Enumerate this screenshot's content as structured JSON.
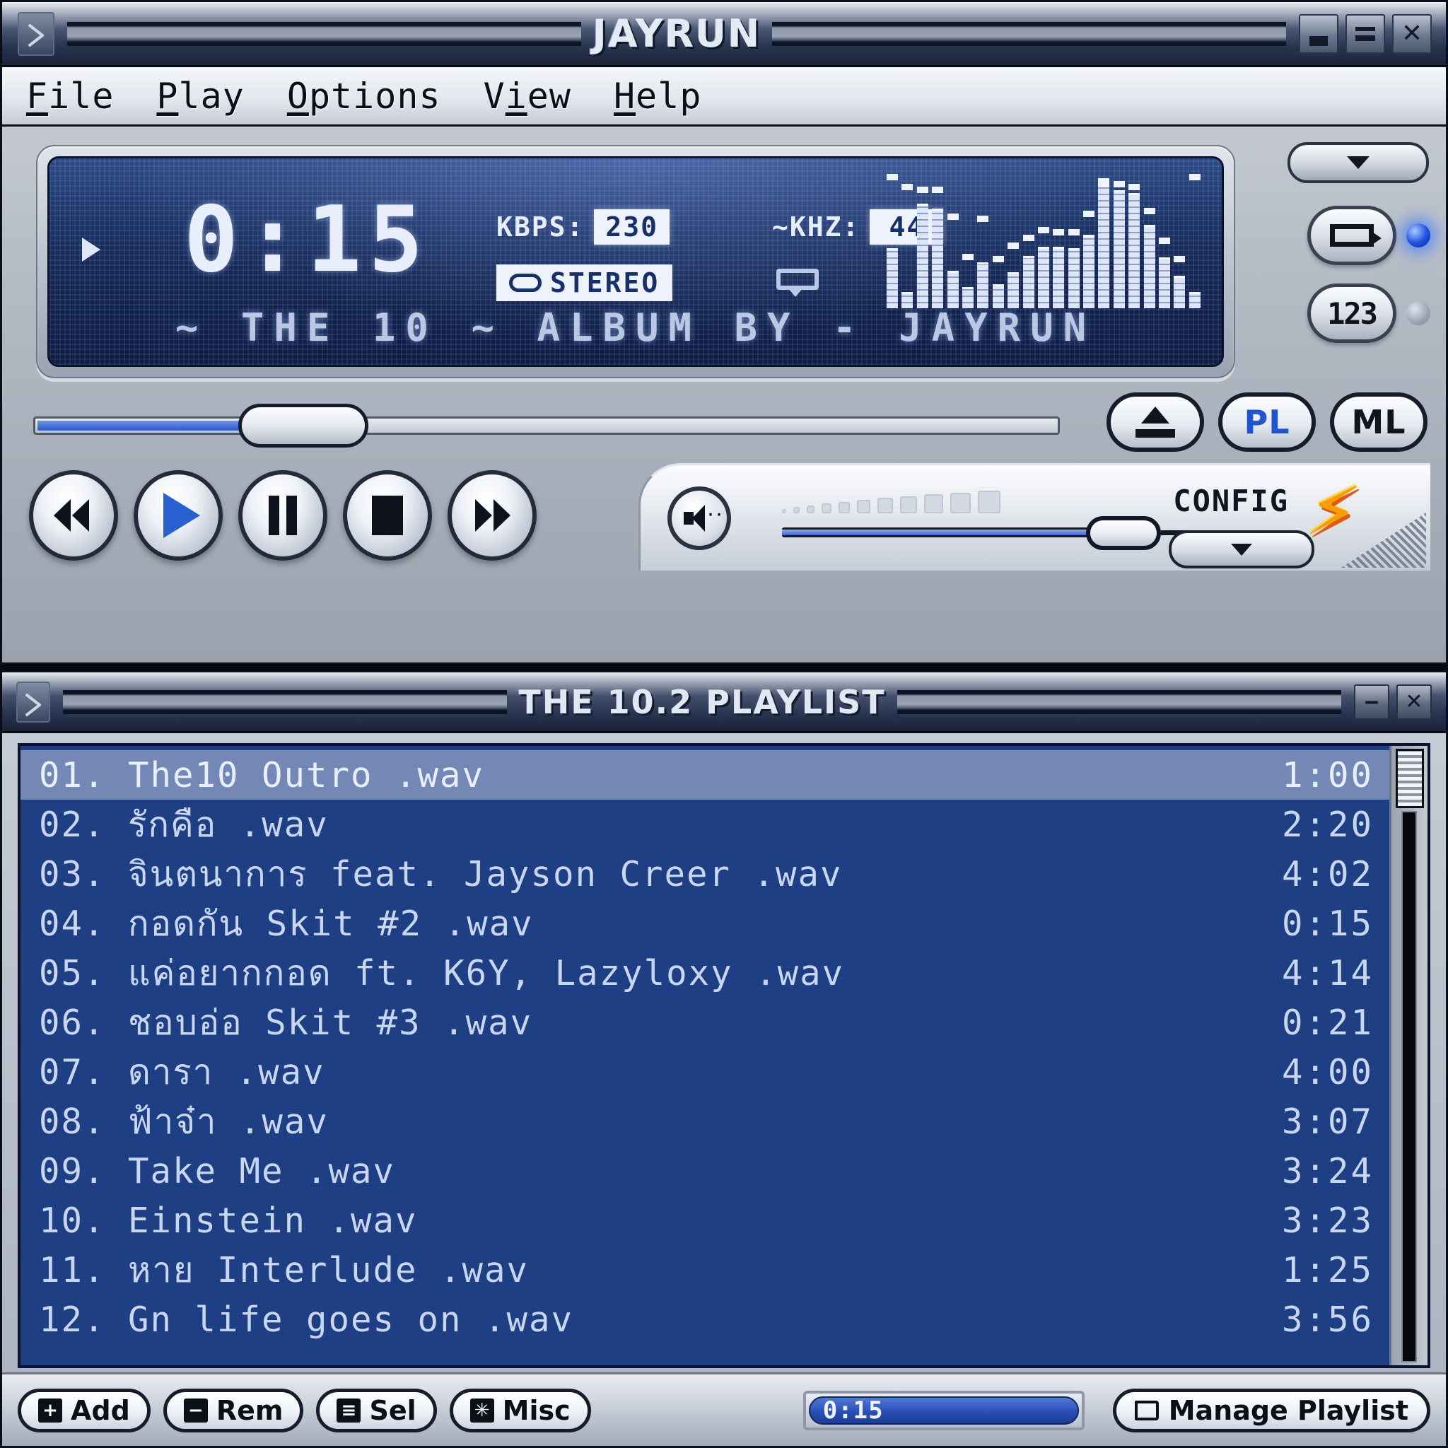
{
  "main_window": {
    "title": "JAYRUN",
    "sys_icon": "winamp-logo-icon",
    "window_buttons": [
      {
        "name": "minimize-button",
        "glyph": "minimize-icon"
      },
      {
        "name": "shade-button",
        "glyph": "shade-icon"
      },
      {
        "name": "close-button",
        "glyph": "close-icon"
      }
    ],
    "menu": [
      {
        "pre": "",
        "acc": "F",
        "post": "ile"
      },
      {
        "pre": "",
        "acc": "P",
        "post": "lay"
      },
      {
        "pre": "",
        "acc": "O",
        "post": "ptions"
      },
      {
        "pre": "V",
        "acc": "i",
        "post": "ew"
      },
      {
        "pre": "",
        "acc": "H",
        "post": "elp"
      }
    ],
    "display": {
      "time": "0:15",
      "play_state": "playing",
      "kbps_label": "KBPS:",
      "kbps_value": "230",
      "khz_label": "~KHZ:",
      "khz_value": "44",
      "stereo_label": "STEREO",
      "track_title": "~ THE 10 ~ ALBUM BY - JAYRUN",
      "spectrum_bars": [
        45,
        12,
        78,
        74,
        28,
        16,
        34,
        18,
        27,
        39,
        46,
        46,
        45,
        55,
        92,
        88,
        86,
        62,
        38,
        24,
        12
      ],
      "spectrum_peaks": [
        96,
        88,
        86,
        86,
        66,
        36,
        64,
        34,
        44,
        50,
        56,
        54,
        54,
        68,
        92,
        90,
        88,
        70,
        48,
        34,
        96
      ]
    },
    "repeat": {
      "label": "repeat-button",
      "led": "on"
    },
    "shuffle": {
      "label": "123",
      "led": "off"
    },
    "eject_label": "eject-button",
    "playlist_toggle": "PL",
    "library_toggle": "ML",
    "seek_percent": 20,
    "volume_percent": 88,
    "config_label": "CONFIG",
    "brand_icon": "lightning-bolt-logo"
  },
  "playlist_window": {
    "title": "THE 10.2 PLAYLIST",
    "window_buttons": [
      {
        "name": "shade-button",
        "glyph": "shade-icon"
      },
      {
        "name": "close-button",
        "glyph": "close-icon"
      }
    ],
    "selected_index": 0,
    "tracks": [
      {
        "num": "01.",
        "name": "The10 Outro .wav",
        "dur": "1:00"
      },
      {
        "num": "02.",
        "name": "รักคือ .wav",
        "dur": "2:20"
      },
      {
        "num": "03.",
        "name": "จินตนาการ feat. Jayson Creer .wav",
        "dur": "4:02"
      },
      {
        "num": "04.",
        "name": "กอดกัน Skit #2 .wav",
        "dur": "0:15"
      },
      {
        "num": "05.",
        "name": "แค่อยากกอด  ft. K6Y, Lazyloxy .wav",
        "dur": "4:14"
      },
      {
        "num": "06.",
        "name": "ชอบอ่อ Skit #3 .wav",
        "dur": "0:21"
      },
      {
        "num": "07.",
        "name": "ดารา .wav",
        "dur": "4:00"
      },
      {
        "num": "08.",
        "name": "ฟ้าจ๋า .wav",
        "dur": "3:07"
      },
      {
        "num": "09.",
        "name": "Take Me .wav",
        "dur": "3:24"
      },
      {
        "num": "10.",
        "name": " Einstein .wav",
        "dur": "3:23"
      },
      {
        "num": "11.",
        "name": " หาย Interlude .wav",
        "dur": "1:25"
      },
      {
        "num": "12.",
        "name": " Gn life goes on .wav",
        "dur": "3:56"
      }
    ],
    "buttons": [
      {
        "icon": "+",
        "label": "Add",
        "name": "add-button"
      },
      {
        "icon": "−",
        "label": "Rem",
        "name": "remove-button"
      },
      {
        "icon": "≡",
        "label": "Sel",
        "name": "select-button"
      },
      {
        "icon": "✳",
        "label": "Misc",
        "name": "misc-button"
      }
    ],
    "elapsed": "0:15",
    "manage_label": "Manage Playlist"
  }
}
